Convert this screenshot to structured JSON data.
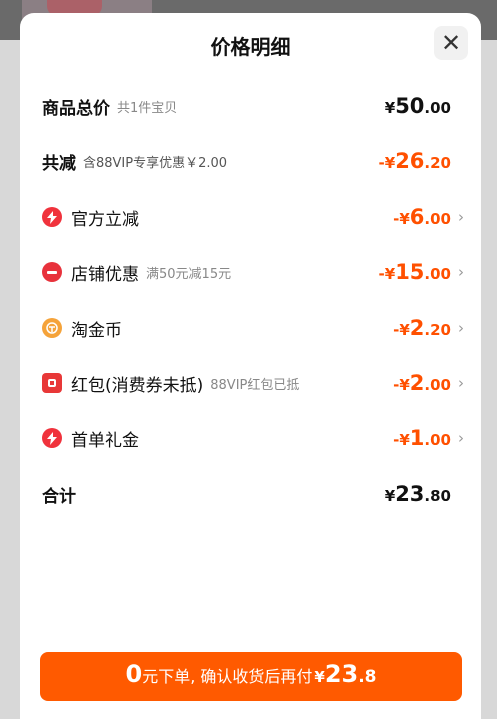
{
  "header": {
    "title": "价格明细",
    "close_glyph": "✕"
  },
  "rows": {
    "total": {
      "label": "商品总价",
      "sub": "共1件宝贝",
      "currency": "¥",
      "int": "50",
      "dec": ".00"
    },
    "reduce": {
      "label": "共减",
      "sub": "含88VIP专享优惠￥2.00",
      "currency": "-¥",
      "int": "26",
      "dec": ".20"
    },
    "official": {
      "icon": "bolt-icon",
      "label": "官方立减",
      "currency": "-¥",
      "int": "6",
      "dec": ".00"
    },
    "shop": {
      "icon": "shop-coupon-icon",
      "label": "店铺优惠",
      "sub": "满50元减15元",
      "currency": "-¥",
      "int": "15",
      "dec": ".00"
    },
    "taojinbi": {
      "icon": "coin-icon",
      "label": "淘金币",
      "currency": "-¥",
      "int": "2",
      "dec": ".20"
    },
    "redpacket": {
      "icon": "red-packet-icon",
      "label": "红包(消费券未抵)",
      "sub": "88VIP红包已抵",
      "currency": "-¥",
      "int": "2",
      "dec": ".00"
    },
    "firstorder": {
      "icon": "bolt-icon",
      "label": "首单礼金",
      "currency": "-¥",
      "int": "1",
      "dec": ".00"
    },
    "sum": {
      "label": "合计",
      "currency": "¥",
      "int": "23",
      "dec": ".80"
    }
  },
  "chevron": "›",
  "cta": {
    "zero": "0",
    "text": "元下单, 确认收货后再付",
    "currency": "¥",
    "int": "23",
    "dec": ".8"
  },
  "colors": {
    "accent": "#ff5000",
    "button": "#ff5a00"
  }
}
